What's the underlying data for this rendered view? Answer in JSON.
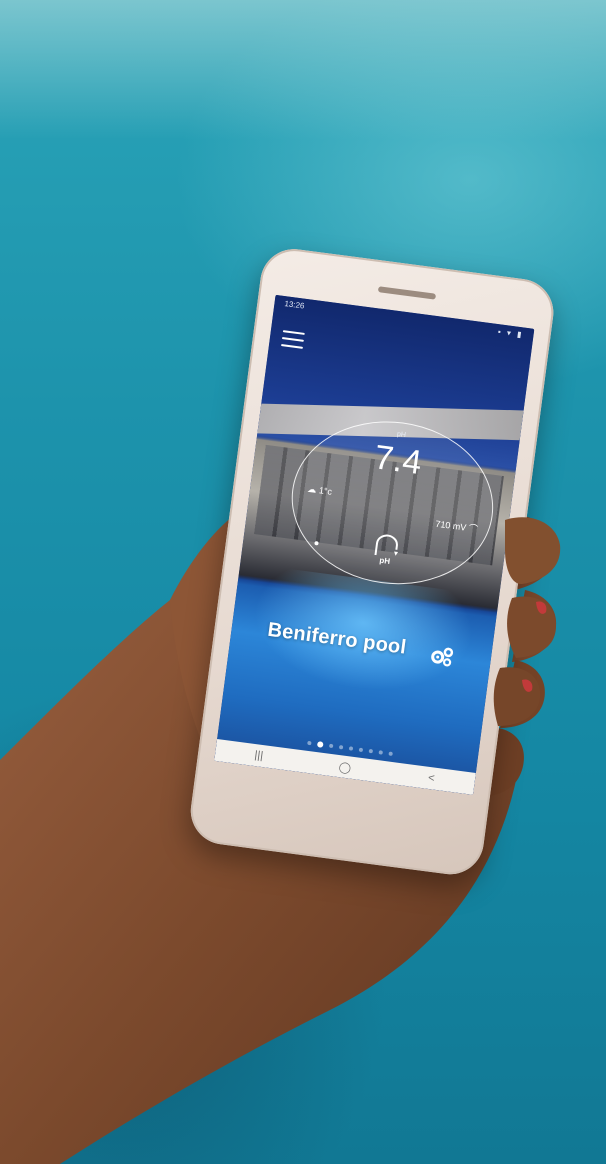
{
  "status_bar": {
    "time": "13:26",
    "right_icons": "▪ ▾ ▮"
  },
  "gauge": {
    "top_label": "pH",
    "ph_value": "7.4",
    "temperature": "1°c",
    "orp": "710 mV",
    "ph_label": "pH"
  },
  "pool": {
    "name": "Beniferro pool"
  },
  "pager": {
    "pages": 9,
    "active_index": 1
  },
  "navbar": {
    "recent": "|||",
    "home": "◯",
    "back": "<"
  },
  "colors": {
    "background": "#1d93ac",
    "phone_body": "#e6d9d0",
    "screen_sky": "#12317e",
    "pool_water": "#2c86d8",
    "skin": "#8a5334"
  }
}
